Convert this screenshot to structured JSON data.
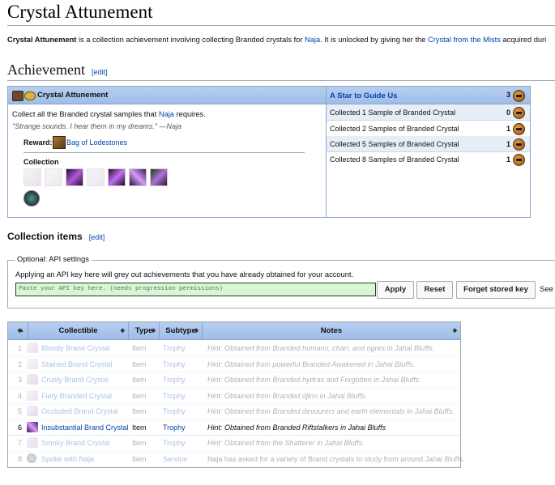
{
  "page": {
    "title": "Crystal Attunement",
    "intro": {
      "bold": "Crystal Attunement",
      "text1": " is a collection achievement involving collecting Branded crystals for ",
      "link1": "Naja",
      "text2": ". It is unlocked by giving her the ",
      "link2": "Crystal from the Mists",
      "text3": " acquired duri"
    }
  },
  "achievement_section": {
    "heading": "Achievement",
    "edit": "[edit]"
  },
  "achievement": {
    "name": "Crystal Attunement",
    "description_prefix": "Collect all the Branded crystal samples that ",
    "description_link": "Naja",
    "description_suffix": " requires.",
    "quote": "\"Strange sounds. I hear them in my dreams.\" —Naja",
    "reward_label": "Reward:",
    "reward_item": "Bag of Lodestones",
    "collection_label": "Collection",
    "series_title": "A Star to Guide Us",
    "series_points": "3",
    "tiers": [
      {
        "label": "Collected 1 Sample of Branded Crystal",
        "points": "0"
      },
      {
        "label": "Collected 2 Samples of Branded Crystal",
        "points": "1"
      },
      {
        "label": "Collected 5 Samples of Branded Crystal",
        "points": "1"
      },
      {
        "label": "Collected 8 Samples of Branded Crystal",
        "points": "1"
      }
    ],
    "colors": {
      "header": "#9fbde8",
      "border": "#8aa5c8",
      "row_alt": "#e8eef7"
    }
  },
  "collection_section": {
    "heading": "Collection items",
    "edit": "[edit]"
  },
  "api": {
    "legend": "Optional: API settings",
    "text": "Applying an API key here will grey out achievements that you have already obtained for your account.",
    "placeholder": "Paste your API key here. (needs progression permissions)",
    "apply": "Apply",
    "reset": "Reset",
    "forget": "Forget stored key",
    "see": "See"
  },
  "table": {
    "headers": {
      "collectible": "Collectible",
      "type": "Type",
      "subtype": "Subtype",
      "notes": "Notes"
    },
    "rows": [
      {
        "num": "1",
        "name": "Bloody Brand Crystal",
        "type": "Item",
        "subtype": "Trophy",
        "notes": "Hint: Obtained from Branded humans, charr, and ogres in Jahai Bluffs.",
        "faded": true,
        "italic": true
      },
      {
        "num": "2",
        "name": "Stained Brand Crystal",
        "type": "Item",
        "subtype": "Trophy",
        "notes": "Hint: Obtained from powerful Branded Awakened in Jahai Bluffs.",
        "faded": true,
        "italic": true
      },
      {
        "num": "3",
        "name": "Crusty Brand Crystal",
        "type": "Item",
        "subtype": "Trophy",
        "notes": "Hint: Obtained from Branded hydras and Forgotten in Jahai Bluffs.",
        "faded": true,
        "italic": true
      },
      {
        "num": "4",
        "name": "Fiery Branded Crystal",
        "type": "Item",
        "subtype": "Trophy",
        "notes": "Hint: Obtained from Branded djinn in Jahai Bluffs.",
        "faded": true,
        "italic": true
      },
      {
        "num": "5",
        "name": "Occluded Brand Crystal",
        "type": "Item",
        "subtype": "Trophy",
        "notes": "Hint: Obtained from Branded devourers and earth elementals in Jahai Bluffs.",
        "faded": true,
        "italic": true
      },
      {
        "num": "6",
        "name": "Insubstantial Brand Crystal",
        "type": "Item",
        "subtype": "Trophy",
        "notes": "Hint: Obtained from Branded Riftstalkers in Jahai Bluffs",
        "faded": false,
        "italic": true
      },
      {
        "num": "7",
        "name": "Smoky Brand Crystal",
        "type": "Item",
        "subtype": "Trophy",
        "notes": "Hint: Obtained from the Shatterer in Jahai Bluffs.",
        "faded": true,
        "italic": true
      },
      {
        "num": "8",
        "name": "Spoke with Naja",
        "type": "Item",
        "subtype": "Service",
        "notes": "Naja has asked for a variety of Brand crystals to study from around Jahai Bluffs.",
        "faded": true,
        "italic": false
      }
    ]
  }
}
